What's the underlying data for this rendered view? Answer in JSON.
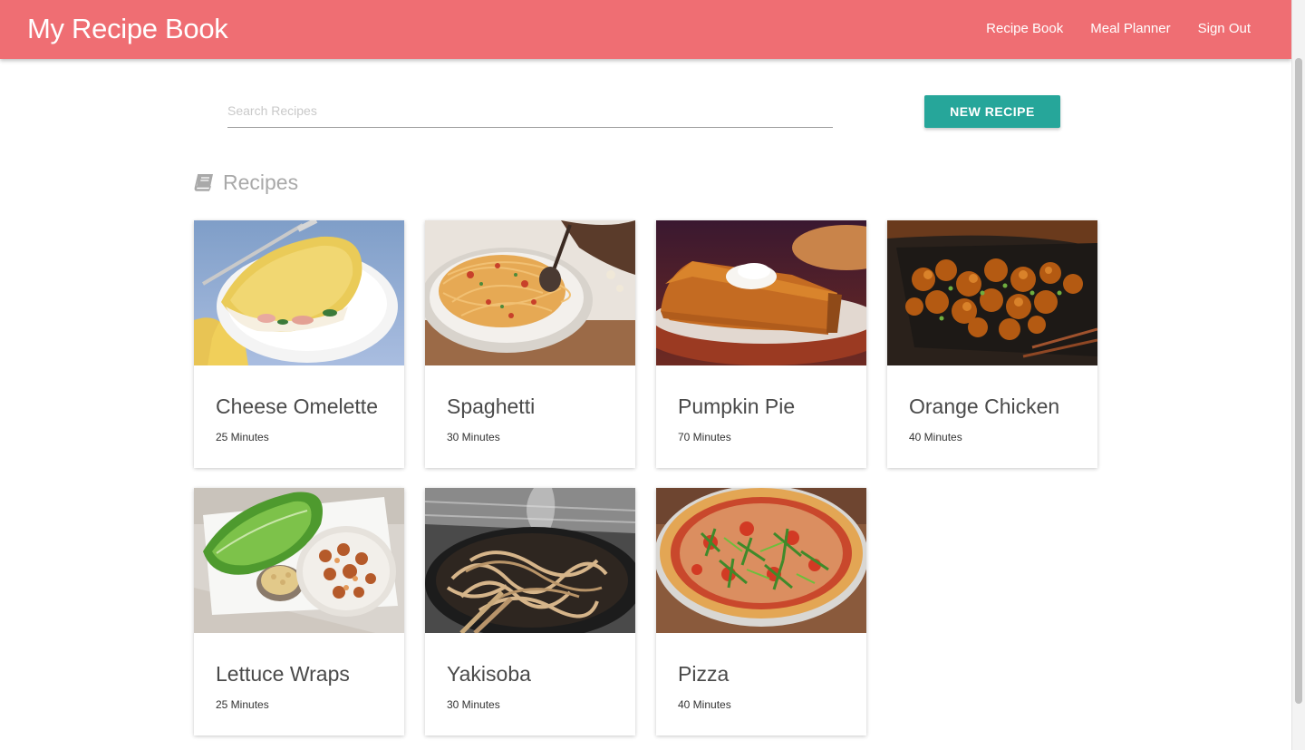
{
  "navbar": {
    "brand": "My Recipe Book",
    "links": [
      "Recipe Book",
      "Meal Planner",
      "Sign Out"
    ],
    "color": "#ef6e73"
  },
  "search": {
    "placeholder": "Search Recipes",
    "value": ""
  },
  "new_recipe_label": "NEW RECIPE",
  "accent_color": "#26a69a",
  "section": {
    "title": "Recipes",
    "icon": "book-icon"
  },
  "recipes": [
    {
      "name": "Cheese Omelette",
      "time": "25 Minutes",
      "image": "omelette-photo"
    },
    {
      "name": "Spaghetti",
      "time": "30 Minutes",
      "image": "spaghetti-photo"
    },
    {
      "name": "Pumpkin Pie",
      "time": "70 Minutes",
      "image": "pumpkin-pie-photo"
    },
    {
      "name": "Orange Chicken",
      "time": "40 Minutes",
      "image": "orange-chicken-photo"
    },
    {
      "name": "Lettuce Wraps",
      "time": "25 Minutes",
      "image": "lettuce-wraps-photo"
    },
    {
      "name": "Yakisoba",
      "time": "30 Minutes",
      "image": "yakisoba-photo"
    },
    {
      "name": "Pizza",
      "time": "40 Minutes",
      "image": "pizza-photo"
    }
  ]
}
